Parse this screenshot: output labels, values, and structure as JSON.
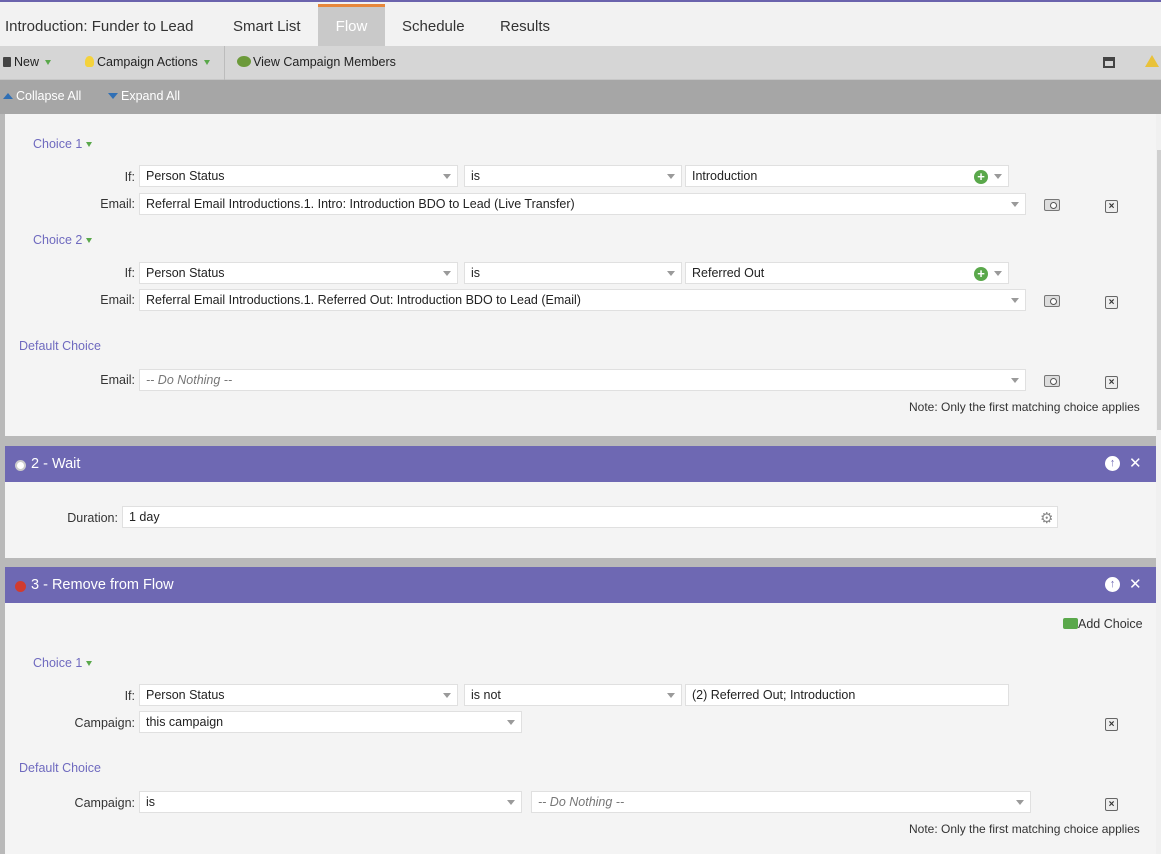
{
  "tabs": {
    "campaign_name": "Introduction: Funder to Lead",
    "smart_list": "Smart List",
    "flow": "Flow",
    "schedule": "Schedule",
    "results": "Results"
  },
  "toolbar": {
    "new": "New",
    "campaign_actions": "Campaign Actions",
    "view_members": "View Campaign Members",
    "collapse_all": "Collapse All",
    "expand_all": "Expand All"
  },
  "step1": {
    "choice1": {
      "label": "Choice 1",
      "if_label": "If:",
      "field": "Person Status",
      "operator": "is",
      "value": "Introduction",
      "email_label": "Email:",
      "email": "Referral Email Introductions.1. Intro: Introduction BDO to Lead (Live Transfer)"
    },
    "choice2": {
      "label": "Choice 2",
      "if_label": "If:",
      "field": "Person Status",
      "operator": "is",
      "value": "Referred Out",
      "email_label": "Email:",
      "email": "Referral Email Introductions.1. Referred Out: Introduction BDO to Lead (Email)"
    },
    "default": {
      "label": "Default Choice",
      "email_label": "Email:",
      "email": "-- Do Nothing --"
    },
    "note": "Note: Only the first matching choice applies"
  },
  "step2": {
    "title": "2 - Wait",
    "duration_label": "Duration:",
    "duration": "1 day"
  },
  "step3": {
    "title": "3 - Remove from Flow",
    "add_choice": "Add Choice",
    "choice1": {
      "label": "Choice 1",
      "if_label": "If:",
      "field": "Person Status",
      "operator": "is not",
      "value": "(2) Referred Out; Introduction",
      "campaign_label": "Campaign:",
      "campaign": "this campaign"
    },
    "default": {
      "label": "Default Choice",
      "campaign_label": "Campaign:",
      "operator": "is",
      "value": "-- Do Nothing --"
    },
    "note": "Note: Only the first matching choice applies"
  },
  "colors": {
    "accent_purple": "#6e68b3",
    "active_tab_border": "#e8873a",
    "add_green": "#5aa84b"
  }
}
